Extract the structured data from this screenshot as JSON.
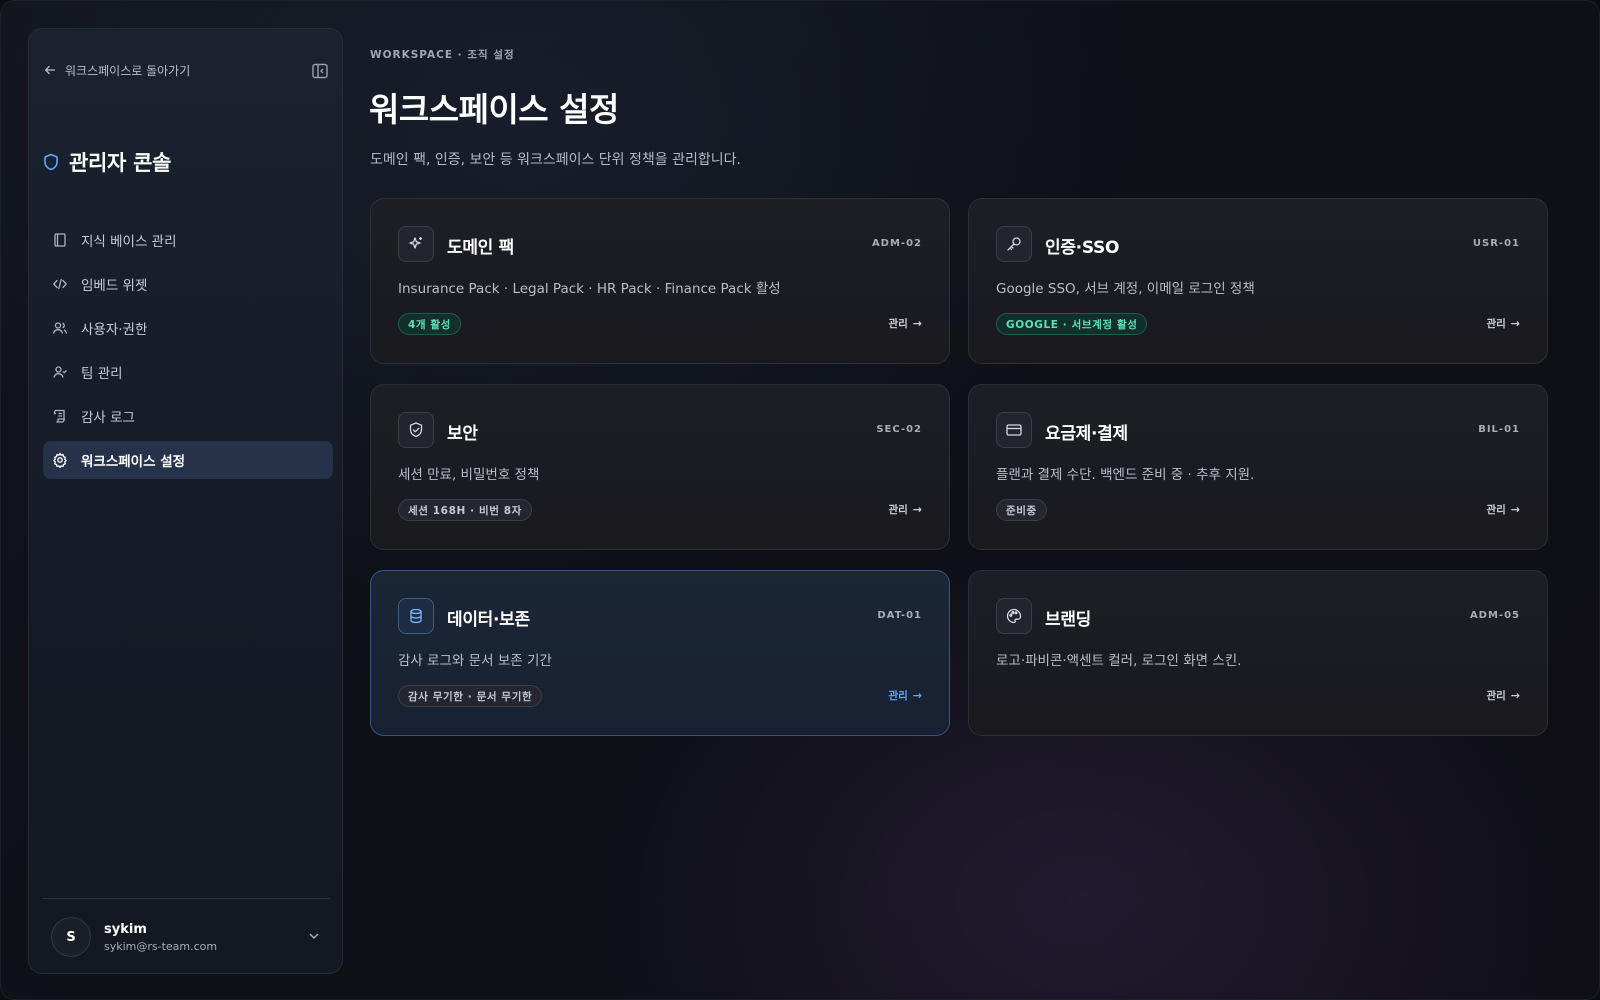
{
  "sidebar": {
    "back_label": "워크스페이스로 돌아가기",
    "console_title": "관리자 콘솔",
    "items": [
      {
        "label": "지식 베이스 관리",
        "icon": "book-icon"
      },
      {
        "label": "임베드 위젯",
        "icon": "code-icon"
      },
      {
        "label": "사용자·권한",
        "icon": "users-icon"
      },
      {
        "label": "팀 관리",
        "icon": "team-icon"
      },
      {
        "label": "감사 로그",
        "icon": "scroll-icon"
      },
      {
        "label": "워크스페이스 설정",
        "icon": "gear-icon",
        "active": true
      }
    ],
    "user": {
      "initial": "S",
      "name": "sykim",
      "email": "sykim@rs-team.com"
    }
  },
  "header": {
    "eyebrow": "WORKSPACE · 조직 설정",
    "title": "워크스페이스 설정",
    "description": "도메인 팩, 인증, 보안 등 워크스페이스 단위 정책을 관리합니다."
  },
  "cards": [
    {
      "title": "도메인 팩",
      "code": "ADM-02",
      "icon": "sparkle-icon",
      "desc": "Insurance Pack · Legal Pack · HR Pack · Finance Pack 활성",
      "badge": "4개 활성",
      "badge_style": "green",
      "manage": "관리"
    },
    {
      "title": "인증·SSO",
      "code": "USR-01",
      "icon": "key-icon",
      "desc": "Google SSO, 서브 계정, 이메일 로그인 정책",
      "badge": "GOOGLE · 서브계정 활성",
      "badge_style": "green",
      "manage": "관리"
    },
    {
      "title": "보안",
      "code": "SEC-02",
      "icon": "shield-icon",
      "desc": "세션 만료, 비밀번호 정책",
      "badge": "세션 168H · 비번 8자",
      "badge_style": "neutral",
      "manage": "관리"
    },
    {
      "title": "요금제·결제",
      "code": "BIL-01",
      "icon": "credit-card-icon",
      "desc": "플랜과 결제 수단. 백엔드 준비 중 · 추후 지원.",
      "badge": "준비중",
      "badge_style": "neutral",
      "manage": "관리"
    },
    {
      "title": "데이터·보존",
      "code": "DAT-01",
      "icon": "database-icon",
      "desc": "감사 로그와 문서 보존 기간",
      "badge": "감사 무기한 · 문서 무기한",
      "badge_style": "neutral",
      "manage": "관리",
      "highlight": true
    },
    {
      "title": "브랜딩",
      "code": "ADM-05",
      "icon": "palette-icon",
      "desc": "로고·파비콘·액센트 컬러, 로그인 화면 스킨.",
      "manage": "관리"
    }
  ],
  "colors": {
    "accent": "#5ea6ff",
    "success": "#5ee0b6",
    "active_nav": "#25324a"
  }
}
